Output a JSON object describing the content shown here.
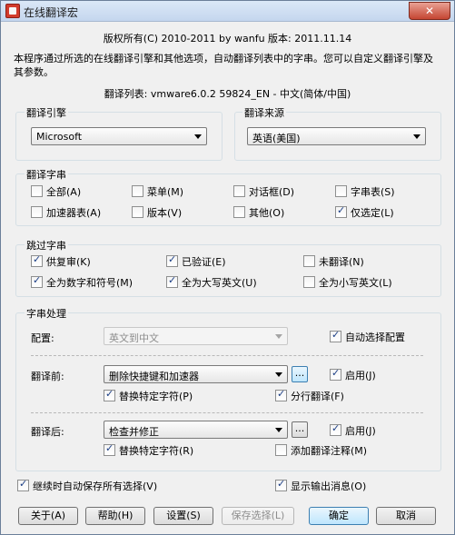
{
  "window": {
    "title": "在线翻译宏",
    "close_glyph": "✕"
  },
  "header": {
    "copyright": "版权所有(C) 2010-2011 by wanfu  版本: 2011.11.14",
    "description": "本程序通过所选的在线翻译引擎和其他选项，自动翻译列表中的字串。您可以自定义翻译引擎及其参数。",
    "list_label": "翻译列表: vmware6.0.2 59824_EN - 中文(简体/中国)"
  },
  "engine": {
    "label": "翻译引擎",
    "value": "Microsoft"
  },
  "source": {
    "label": "翻译来源",
    "value": "英语(美国)"
  },
  "strings": {
    "label": "翻译字串",
    "items": [
      {
        "label": "全部(A)",
        "checked": false
      },
      {
        "label": "菜单(M)",
        "checked": false
      },
      {
        "label": "对话框(D)",
        "checked": false
      },
      {
        "label": "字串表(S)",
        "checked": false
      },
      {
        "label": "加速器表(A)",
        "checked": false
      },
      {
        "label": "版本(V)",
        "checked": false
      },
      {
        "label": "其他(O)",
        "checked": false
      },
      {
        "label": "仅选定(L)",
        "checked": true
      }
    ]
  },
  "skip": {
    "label": "跳过字串",
    "items": [
      {
        "label": "供复审(K)",
        "checked": true
      },
      {
        "label": "已验证(E)",
        "checked": true
      },
      {
        "label": "未翻译(N)",
        "checked": false
      },
      {
        "label": "全为数字和符号(M)",
        "checked": true
      },
      {
        "label": "全为大写英文(U)",
        "checked": true
      },
      {
        "label": "全为小写英文(L)",
        "checked": false
      }
    ]
  },
  "processing": {
    "label": "字串处理",
    "config_label": "配置:",
    "config_value": "英文到中文",
    "auto_select": {
      "label": "自动选择配置",
      "checked": true
    },
    "before": {
      "label": "翻译前:",
      "value": "删除快捷键和加速器",
      "browse": "...",
      "enable": {
        "label": "启用(J)",
        "checked": true
      },
      "replace": {
        "label": "替换特定字符(P)",
        "checked": true
      },
      "split": {
        "label": "分行翻译(F)",
        "checked": true
      }
    },
    "after": {
      "label": "翻译后:",
      "value": "检查并修正",
      "browse": "...",
      "enable": {
        "label": "启用(J)",
        "checked": true
      },
      "replace": {
        "label": "替换特定字符(R)",
        "checked": true
      },
      "annotate": {
        "label": "添加翻译注释(M)",
        "checked": false
      }
    }
  },
  "footer": {
    "autosave": {
      "label": "继续时自动保存所有选择(V)",
      "checked": true
    },
    "show_output": {
      "label": "显示输出消息(O)",
      "checked": true
    },
    "buttons": {
      "about": "关于(A)",
      "help": "帮助(H)",
      "settings": "设置(S)",
      "save_selection": "保存选择(L)",
      "ok": "确定",
      "cancel": "取消"
    }
  }
}
